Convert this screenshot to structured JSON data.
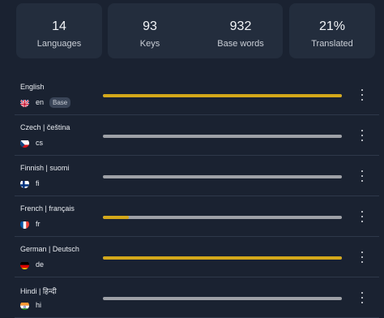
{
  "stats": [
    {
      "value": "14",
      "label": "Languages"
    },
    {
      "value": "93",
      "label": "Keys"
    },
    {
      "value": "932",
      "label": "Base words"
    },
    {
      "value": "21%",
      "label": "Translated"
    }
  ],
  "languages": [
    {
      "name": "English",
      "code": "en",
      "badge": "Base",
      "flag": "uk-flag-icon",
      "progress": 1.0
    },
    {
      "name": "Czech | čeština",
      "code": "cs",
      "flag": "czech-flag-icon",
      "progress": 0.0
    },
    {
      "name": "Finnish | suomi",
      "code": "fi",
      "flag": "finnish-flag-icon",
      "progress": 0.0
    },
    {
      "name": "French | français",
      "code": "fr",
      "flag": "french-flag-icon",
      "progress": 0.11
    },
    {
      "name": "German | Deutsch",
      "code": "de",
      "flag": "german-flag-icon",
      "progress": 1.0
    },
    {
      "name": "Hindi | हिन्दी",
      "code": "hi",
      "flag": "indian-flag-icon",
      "progress": 0.0
    }
  ],
  "colors": {
    "background": "#1a2231",
    "card": "#232d3d",
    "progress_fill": "#d4a81a",
    "progress_track": "#9ea1a7"
  }
}
